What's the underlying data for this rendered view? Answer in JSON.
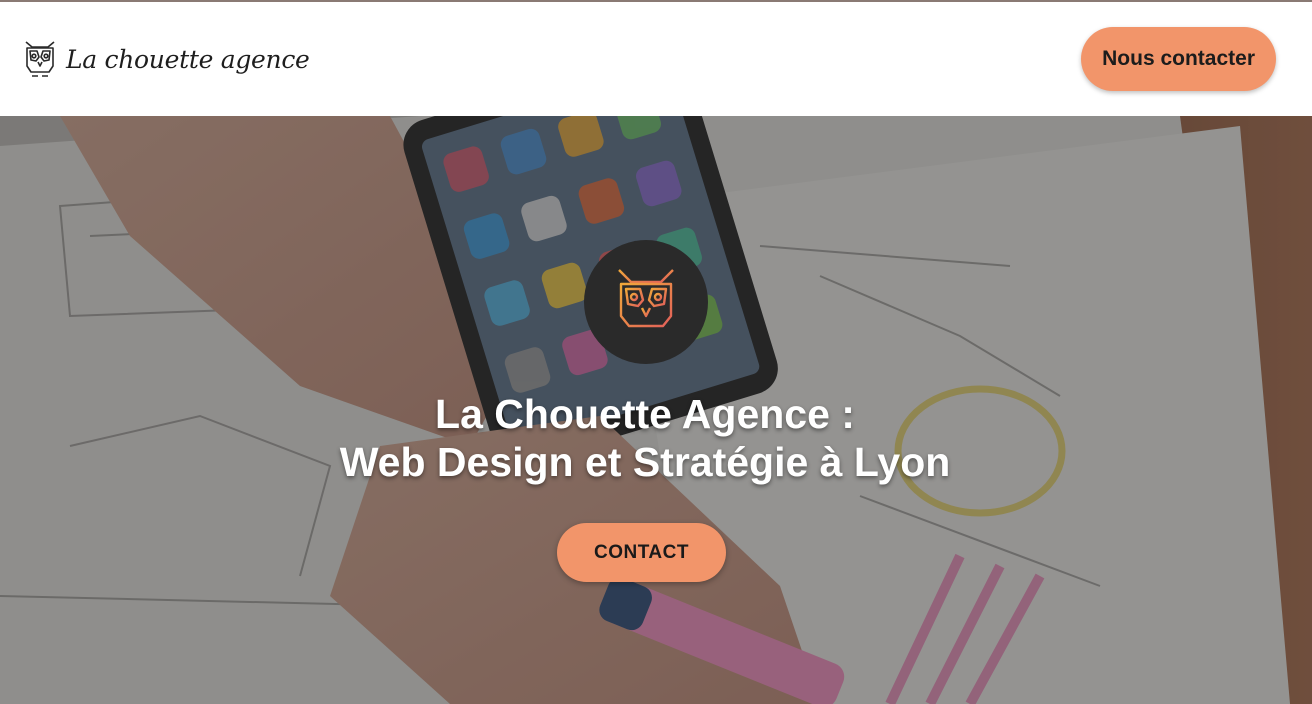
{
  "header": {
    "brand_name": "La chouette agence",
    "brand_logo_icon": "owl-logo-icon",
    "cta_label": "Nous contacter"
  },
  "hero": {
    "background": "desk-phone-sketches-photo",
    "badge_icon": "owl-logo-icon",
    "title_line1": "La Chouette Agence :",
    "title_line2": "Web Design et Stratégie à Lyon",
    "cta_label": "CONTACT"
  },
  "colors": {
    "accent": "#f2956a",
    "badge_bg": "#2a2a2a",
    "logo_gradient_start": "#f0a83a",
    "logo_gradient_end": "#e2605a"
  }
}
